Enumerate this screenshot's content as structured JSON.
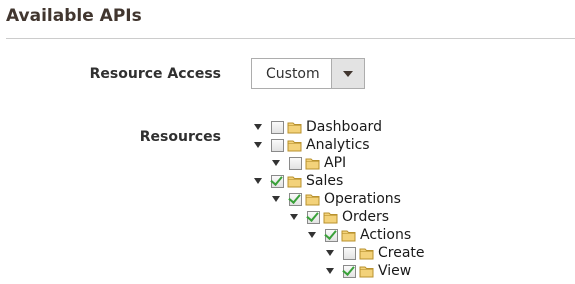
{
  "section": {
    "title": "Available APIs"
  },
  "resource_access": {
    "label": "Resource Access",
    "value": "Custom"
  },
  "resources": {
    "label": "Resources",
    "tree": [
      {
        "label": "Dashboard",
        "checked": false
      },
      {
        "label": "Analytics",
        "checked": false
      },
      {
        "label": "API",
        "checked": false
      },
      {
        "label": "Sales",
        "checked": true
      },
      {
        "label": "Operations",
        "checked": true
      },
      {
        "label": "Orders",
        "checked": true
      },
      {
        "label": "Actions",
        "checked": true
      },
      {
        "label": "Create",
        "checked": false
      },
      {
        "label": "View",
        "checked": true
      }
    ]
  },
  "colors": {
    "checkmark": "#3aa13a",
    "folder": "#e8c25a"
  }
}
